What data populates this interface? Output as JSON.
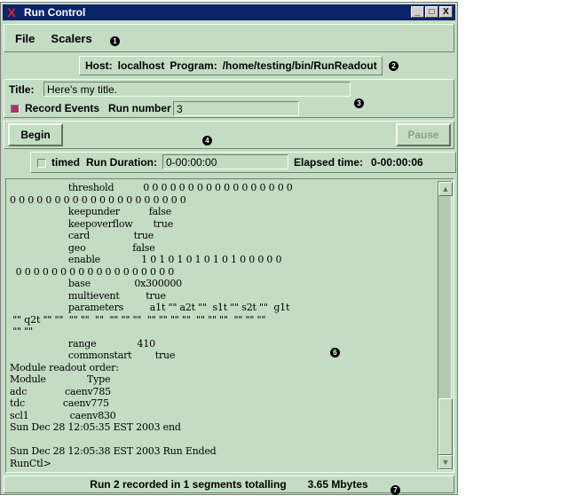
{
  "window": {
    "title": "Run Control",
    "minimize": "_",
    "maximize": "□",
    "close": "X"
  },
  "menu": {
    "file": "File",
    "scalers": "Scalers"
  },
  "host": {
    "host_label": "Host:",
    "host_value": "localhost",
    "program_label": "Program:",
    "program_value": "/home/testing/bin/RunReadout"
  },
  "run": {
    "title_label": "Title:",
    "title_value": "Here's my title.",
    "record_label": "Record Events",
    "record_checked": true,
    "run_number_label": "Run number",
    "run_number_value": "3"
  },
  "buttons": {
    "begin": "Begin",
    "pause": "Pause"
  },
  "duration": {
    "timed_label": "timed",
    "timed_checked": false,
    "run_duration_label": "Run Duration:",
    "run_duration_value": "0-00:00:00",
    "elapsed_label": "Elapsed time:",
    "elapsed_value": "0-00:00:06"
  },
  "console": {
    "text": "                    threshold          0 0 0 0 0 0 0 0 0 0 0 0 0 0 0 0 0\n0 0 0 0 0 0 0 0 0 0 0 0 0 0 0 0 0 0 0 0\n                    keepunder          false\n                    keepoverflow       true\n                    card               true\n                    geo                false\n                    enable              1 0 1 0 1 0 1 0 1 0 1 0 0 0 0 0\n  0 0 0 0 0 0 0 0 0 0 0 0 0 0 0 0 0 0\n                    base               0x300000\n                    multievent         true\n                    parameters         a1t \"\" a2t \"\"  s1t \"\" s2t \"\"  g1t\n \"\" q2t \"\" \"\"  \"\" \"\"  \"\"  \"\" \"\" \"\"  \"\" \"\" \"\" \"\"  \"\" \"\" \"\"  \"\" \"\" \"\"\n \"\" \"\"\n                    range              410\n                    commonstart        true\nModule readout order:\nModule              Type\nadc             caenv785\ntdc             caenv775\nscl1              caenv830\nSun Dec 28 12:05:35 EST 2003 end\n\nSun Dec 28 12:05:38 EST 2003 Run Ended\nRunCtl>"
  },
  "status": {
    "text": "Run 2 recorded in 1 segments totalling",
    "size": "3.65 Mbytes"
  },
  "callouts": [
    "1",
    "2",
    "3",
    "4",
    "6",
    "7"
  ]
}
